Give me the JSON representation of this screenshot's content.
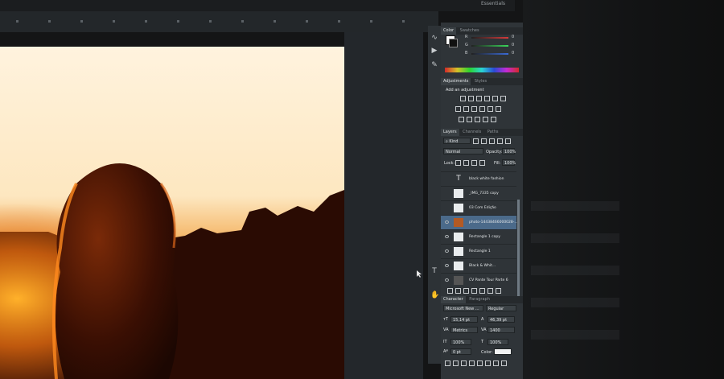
{
  "menubar": {
    "workspace_label": "Essentials"
  },
  "toolbar": {
    "tools": [
      {
        "icon": "lasso-icon"
      },
      {
        "icon": "move-icon"
      },
      {
        "icon": "brush-icon"
      },
      {
        "icon": "type-icon"
      },
      {
        "icon": "hand-icon"
      }
    ]
  },
  "color_panel": {
    "tabs": [
      {
        "label": "Color"
      },
      {
        "label": "Swatches"
      }
    ],
    "channels": [
      {
        "label": "R",
        "value": "0",
        "color": "#d63a3a"
      },
      {
        "label": "G",
        "value": "0",
        "color": "#3ad65a"
      },
      {
        "label": "B",
        "value": "0",
        "color": "#3a6ad6"
      }
    ]
  },
  "adjustments_panel": {
    "tabs": [
      {
        "label": "Adjustments"
      },
      {
        "label": "Styles"
      }
    ],
    "heading": "Add an adjustment"
  },
  "layers_panel": {
    "tabs": [
      {
        "label": "Layers"
      },
      {
        "label": "Channels"
      },
      {
        "label": "Paths"
      }
    ],
    "filter_kind": "Kind",
    "blend_mode": "Normal",
    "opacity_label": "Opacity:",
    "opacity_value": "100%",
    "lock_label": "Lock:",
    "fill_label": "Fill:",
    "fill_value": "100%",
    "layers": [
      {
        "name": "black white fashion",
        "thumb": "T",
        "visible": false,
        "selected": false
      },
      {
        "name": "_IMG_7335 copy",
        "thumb": "",
        "visible": false,
        "selected": false
      },
      {
        "name": "03 Com Edição",
        "thumb": "",
        "visible": false,
        "selected": false
      },
      {
        "name": "photo-14438466000028-...",
        "thumb": "",
        "visible": true,
        "selected": true
      },
      {
        "name": "Rectangle 1 copy",
        "thumb": "",
        "visible": true,
        "selected": false
      },
      {
        "name": "Rectangle 1",
        "thumb": "",
        "visible": true,
        "selected": false
      },
      {
        "name": "Black & Whit...",
        "thumb": "",
        "visible": true,
        "selected": false
      },
      {
        "name": "CV Pante Tour Parte 6",
        "thumb": "",
        "visible": true,
        "selected": false
      }
    ]
  },
  "character_panel": {
    "tabs": [
      {
        "label": "Character"
      },
      {
        "label": "Paragraph"
      }
    ],
    "font_family": "Microsoft New ...",
    "font_style": "Regular",
    "font_size": "15,14 pt",
    "leading": "46,39 pt",
    "kerning": "Metrics",
    "tracking": "1400",
    "vertical_scale": "100%",
    "horizontal_scale": "100%",
    "baseline": "0 pt",
    "color_label": "Color:"
  }
}
